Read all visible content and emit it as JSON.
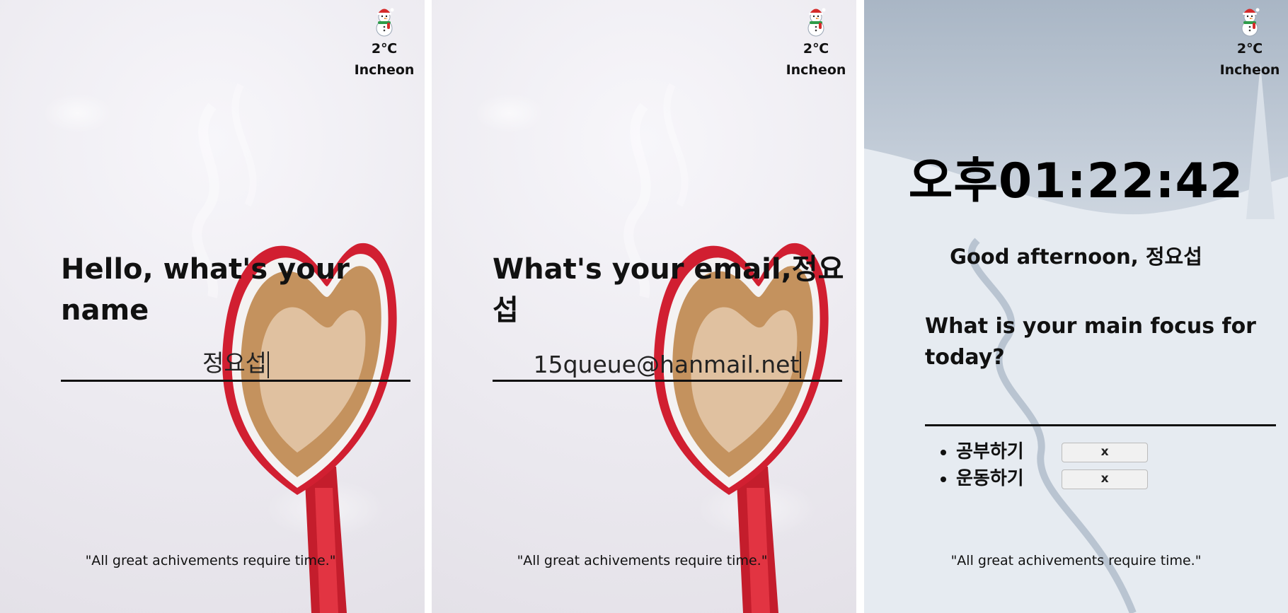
{
  "weather": {
    "temperature": "2℃",
    "city": "Incheon",
    "icon": "snowman-icon"
  },
  "panel_name": {
    "prompt": "Hello, what's your name",
    "input_value": "정요섭"
  },
  "panel_email": {
    "prompt": "What's your email,정요섭",
    "input_value": "15queue@hanmail.net"
  },
  "panel_main": {
    "clock": "오후01:22:42",
    "greeting": "Good afternoon, 정요섭",
    "focus_question": "What is your main focus for today?",
    "focus_input_value": "",
    "todos": [
      {
        "label": "공부하기",
        "delete_label": "x"
      },
      {
        "label": "운동하기",
        "delete_label": "x"
      }
    ]
  },
  "quote": "\"All great achivements require time.\"",
  "colors": {
    "text": "#111111",
    "cup_red": "#c8202e",
    "coffee": "#c79a6a"
  }
}
